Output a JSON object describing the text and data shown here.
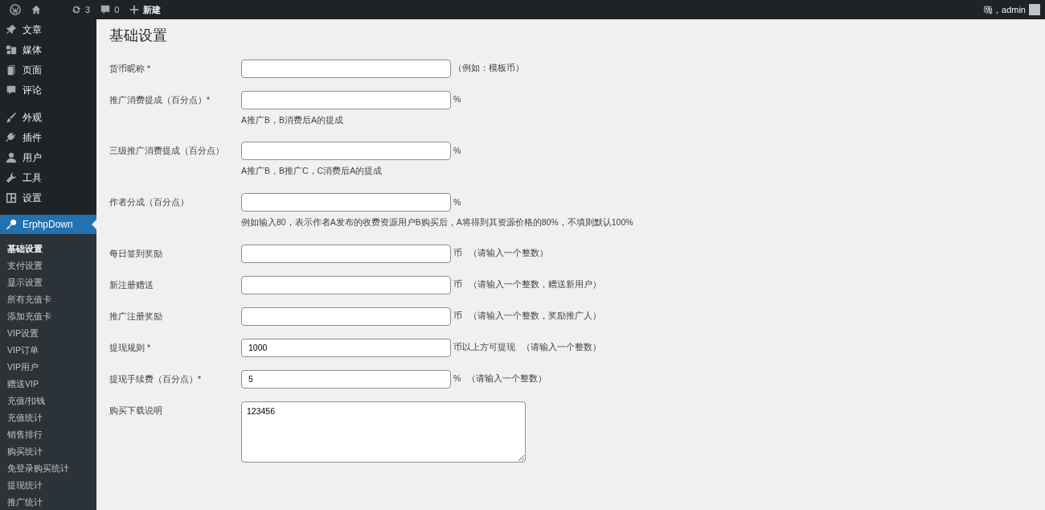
{
  "admin_bar": {
    "items": [
      {
        "kind": "wp-logo"
      },
      {
        "kind": "home"
      },
      {
        "kind": "updates",
        "text": "3"
      },
      {
        "kind": "comments",
        "text": "0"
      },
      {
        "kind": "new",
        "text": "新建"
      }
    ],
    "greeting": "嗨，admin"
  },
  "sidebar": {
    "groups": [
      [
        {
          "kind": "pin",
          "label": "文章",
          "selected": false
        },
        {
          "kind": "media",
          "label": "媒体",
          "selected": false
        },
        {
          "kind": "page",
          "label": "页面",
          "selected": false
        },
        {
          "kind": "comment",
          "label": "评论",
          "selected": false
        }
      ],
      [
        {
          "kind": "brush",
          "label": "外观",
          "selected": false
        },
        {
          "kind": "plug",
          "label": "插件",
          "selected": false
        },
        {
          "kind": "user",
          "label": "用户",
          "selected": false
        },
        {
          "kind": "wrench",
          "label": "工具",
          "selected": false
        },
        {
          "kind": "settings",
          "label": "设置",
          "selected": false
        }
      ],
      [
        {
          "kind": "key",
          "label": "ErphpDown",
          "selected": true
        }
      ]
    ],
    "submenu": [
      {
        "label": "基础设置",
        "selected": true
      },
      {
        "label": "支付设置",
        "selected": false
      },
      {
        "label": "显示设置",
        "selected": false
      },
      {
        "label": "所有充值卡",
        "selected": false
      },
      {
        "label": "添加充值卡",
        "selected": false
      },
      {
        "label": "VIP设置",
        "selected": false
      },
      {
        "label": "VIP订单",
        "selected": false
      },
      {
        "label": "VIP用户",
        "selected": false
      },
      {
        "label": "赠送VIP",
        "selected": false
      },
      {
        "label": "充值/扣钱",
        "selected": false
      },
      {
        "label": "充值统计",
        "selected": false
      },
      {
        "label": "销售排行",
        "selected": false
      },
      {
        "label": "购买统计",
        "selected": false
      },
      {
        "label": "免登录购买统计",
        "selected": false
      },
      {
        "label": "提现统计",
        "selected": false
      },
      {
        "label": "推广统计",
        "selected": false
      }
    ]
  },
  "page_title": "基础设置",
  "fields": [
    {
      "kind": "text",
      "label": "货币昵称 *",
      "suffix": [
        "（例如：模板币）"
      ]
    },
    {
      "kind": "text",
      "label": "推广消费提成（百分点）*",
      "suffix": [
        "%"
      ],
      "description": "A推广B，B消费后A的提成"
    },
    {
      "kind": "text",
      "label": "三级推广消费提成（百分点）",
      "suffix": [
        "%"
      ],
      "description": "A推广B，B推广C，C消费后A的提成"
    },
    {
      "kind": "text",
      "label": "作者分成（百分点）",
      "suffix": [
        "%"
      ],
      "description": "例如输入80，表示作者A发布的收费资源用户B购买后，A将得到其资源价格的80%，不填则默认100%"
    },
    {
      "kind": "text",
      "label": "每日签到奖励",
      "suffix": [
        "币",
        "（请输入一个整数）"
      ]
    },
    {
      "kind": "text",
      "label": "新注册赠送",
      "suffix": [
        "币",
        "（请输入一个整数，赠送新用户）"
      ]
    },
    {
      "kind": "text",
      "label": "推广注册奖励",
      "suffix": [
        "币",
        "（请输入一个整数，奖励推广人）"
      ]
    },
    {
      "kind": "text",
      "label": "提现规则 *",
      "value": "1000",
      "suffix": [
        "币以上方可提现",
        "（请输入一个整数）"
      ]
    },
    {
      "kind": "text",
      "label": "提现手续费（百分点）*",
      "value": "5",
      "suffix": [
        "%",
        "（请输入一个整数）"
      ]
    },
    {
      "kind": "textarea",
      "label": "购买下载说明",
      "value": "123456"
    }
  ]
}
